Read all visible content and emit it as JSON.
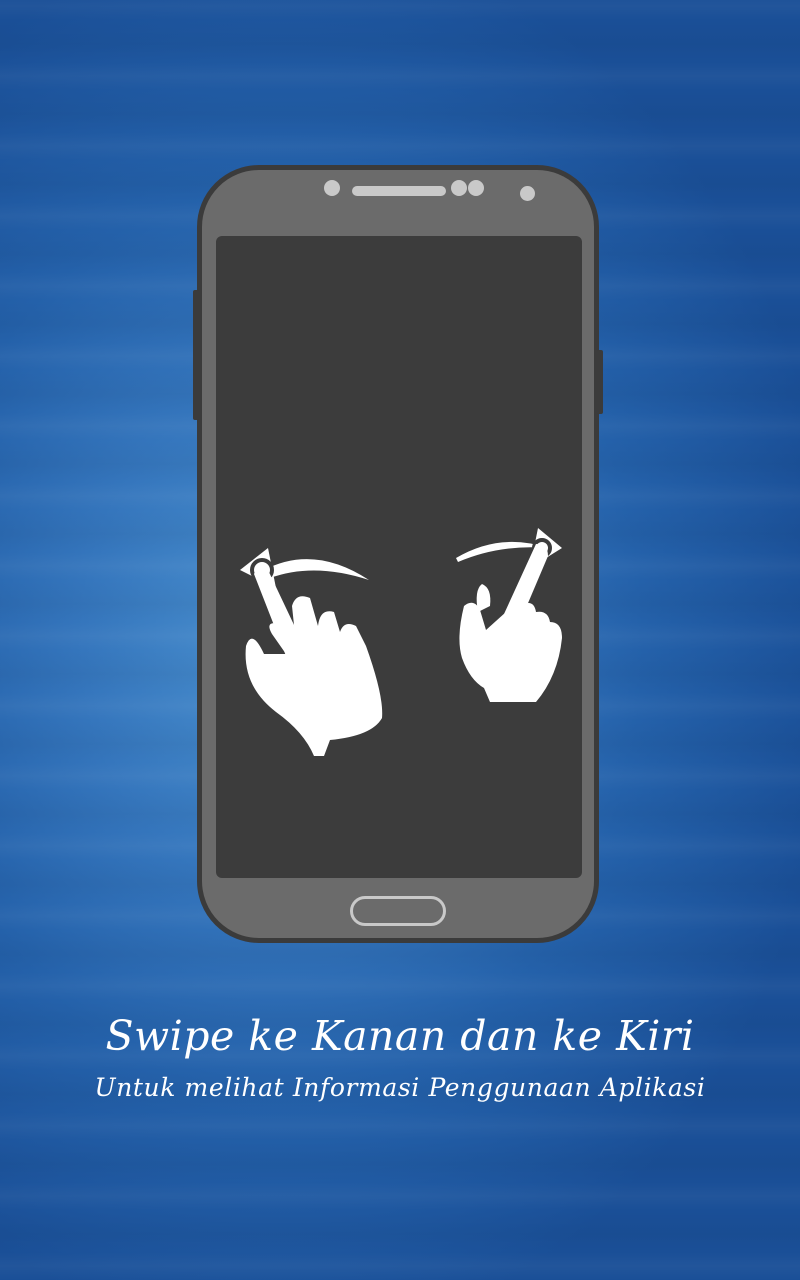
{
  "tutorial": {
    "title": "Swipe ke Kanan dan ke Kiri",
    "subtitle": "Untuk melihat Informasi Penggunaan Aplikasi"
  },
  "icons": {
    "left_gesture": "swipe-left-hand-icon",
    "right_gesture": "swipe-right-hand-icon",
    "device": "smartphone-illustration"
  },
  "colors": {
    "background": "#2a68b3",
    "phone_body": "#6b6b6b",
    "phone_border": "#3b3b3b",
    "screen": "#3c3c3c",
    "accent_light": "#c9c9c9",
    "text": "#ffffff"
  }
}
